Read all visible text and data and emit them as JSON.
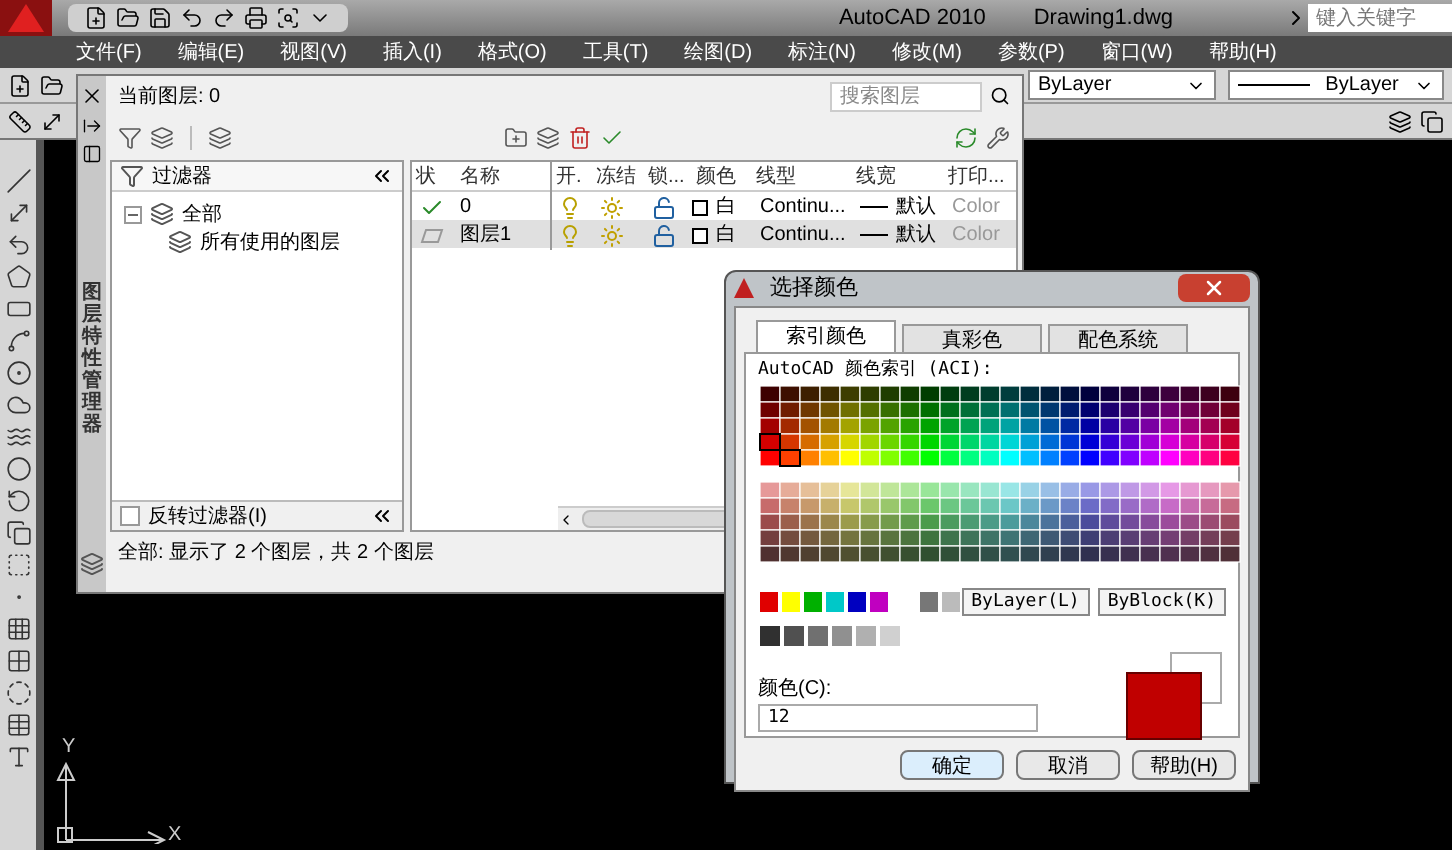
{
  "app": {
    "title": "AutoCAD 2010",
    "file": "Drawing1.dwg",
    "search": {
      "placeholder": "键入关键字"
    }
  },
  "menu": [
    "文件(F)",
    "编辑(E)",
    "视图(V)",
    "插入(I)",
    "格式(O)",
    "工具(T)",
    "绘图(D)",
    "标注(N)",
    "修改(M)",
    "参数(P)",
    "窗口(W)",
    "帮助(H)"
  ],
  "property_dropdowns": [
    {
      "kind": "color",
      "value": "ByLayer"
    },
    {
      "kind": "linetype",
      "value": "ByLayer"
    }
  ],
  "layer_manager": {
    "vertical_title": "图层特性管理器",
    "current_layer": "当前图层: 0",
    "search": {
      "placeholder": "搜索图层"
    },
    "filter_header": "过滤器",
    "filter_tree": [
      {
        "label": "全部",
        "expanded": true,
        "children": [
          {
            "label": "所有使用的图层"
          }
        ]
      }
    ],
    "invert_filter": {
      "label": "反转过滤器(I)",
      "checked": false
    },
    "columns": [
      "状",
      "名称",
      "开.",
      "冻结",
      "锁...",
      "颜色",
      "线型",
      "线宽",
      "打印..."
    ],
    "rows": [
      {
        "kind": "current",
        "selected": false,
        "name": "0",
        "on": true,
        "frozen": false,
        "locked": false,
        "color_name": "白",
        "linetype": "Continu...",
        "lineweight": "默认",
        "plot_style": "Color"
      },
      {
        "kind": "layer",
        "selected": true,
        "name": "图层1",
        "on": true,
        "frozen": false,
        "locked": false,
        "color_name": "白",
        "linetype": "Continu...",
        "lineweight": "默认",
        "plot_style": "Color"
      }
    ],
    "status": "全部: 显示了 2 个图层，共 2 个图层"
  },
  "color_dialog": {
    "title": "选择颜色",
    "tabs": [
      {
        "label": "索引颜色",
        "selected": true
      },
      {
        "label": "真彩色",
        "selected": false
      },
      {
        "label": "配色系统",
        "selected": false
      }
    ],
    "palette_label": "AutoCAD 颜色索引 (ACI):",
    "bylayer": "ByLayer(L)",
    "byblock": "ByBlock(K)",
    "color_label": "颜色(C):",
    "color_value": "12",
    "buttons": [
      "确定",
      "取消",
      "帮助(H)"
    ]
  },
  "ucs": {
    "y_label": "Y",
    "x_label": "X"
  }
}
